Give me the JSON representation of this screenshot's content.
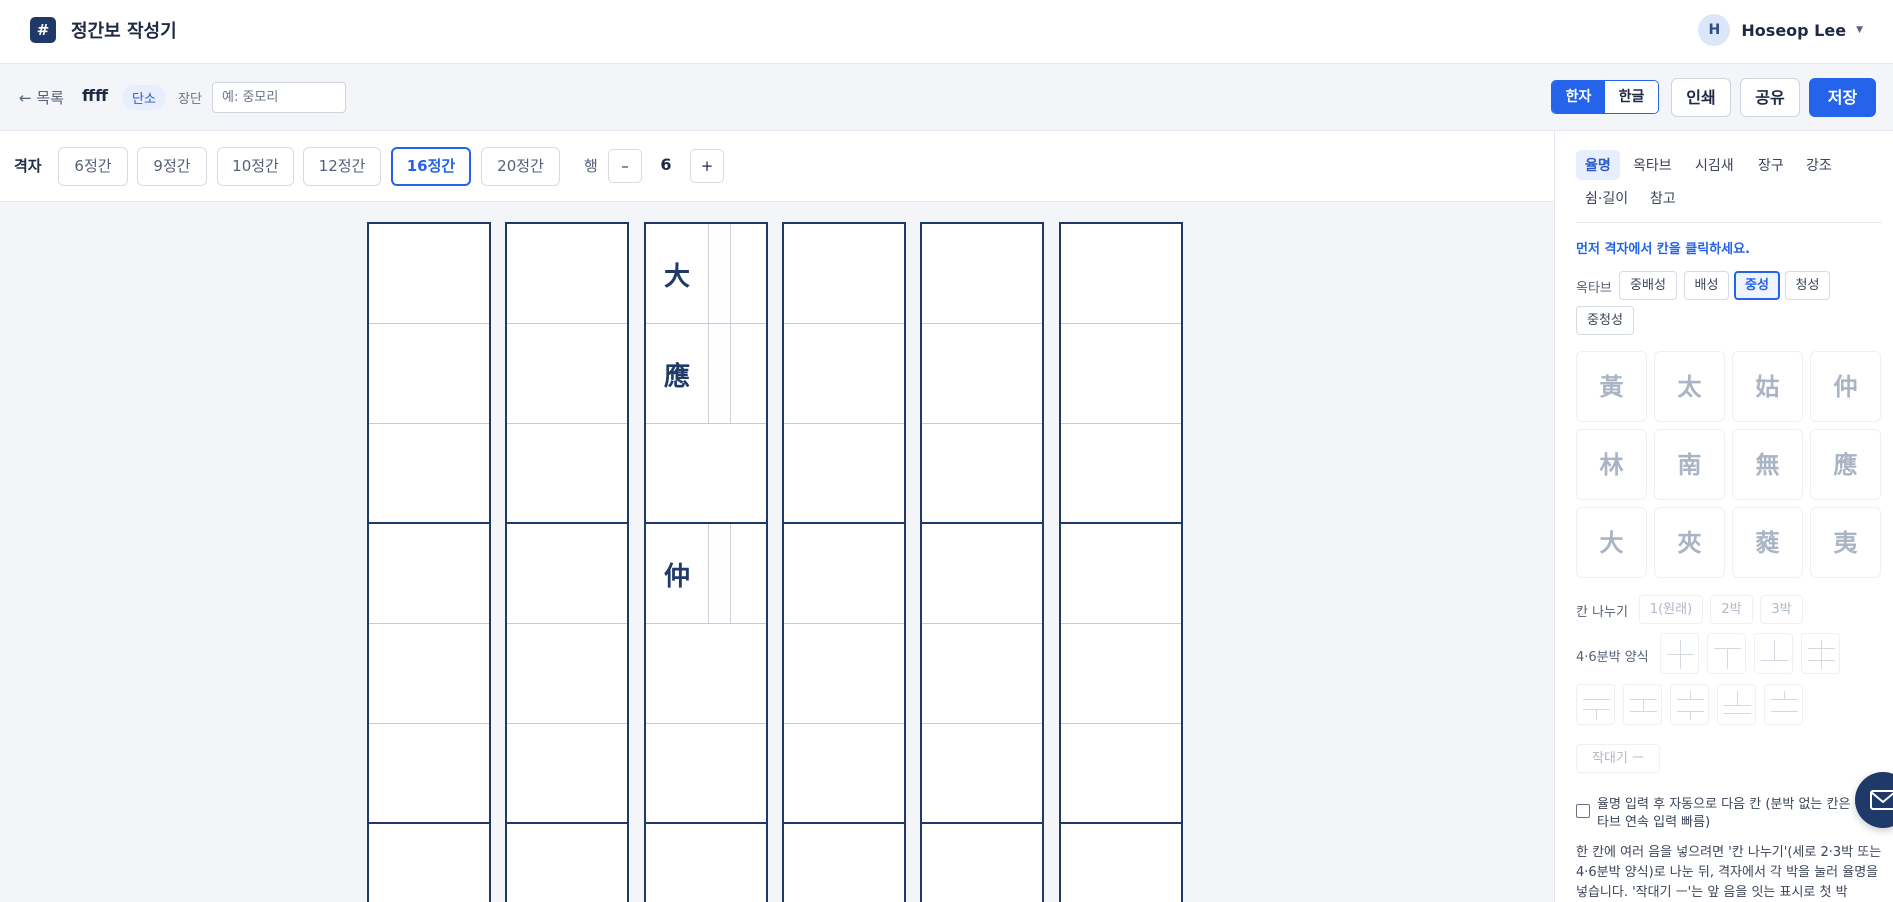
{
  "header": {
    "logo_glyph": "#",
    "app_title": "정간보 작성기",
    "user": {
      "avatar_initial": "H",
      "name": "Hoseop Lee",
      "menu_icon": "caret-down-icon"
    }
  },
  "toolbar": {
    "back_label": "← 목록",
    "document_name": "ffff",
    "type_badge": "단소",
    "jangdan_label": "장단",
    "jangdan_placeholder": "예: 중모리",
    "jangdan_value": "",
    "script_toggle": {
      "options": [
        "한자",
        "한글"
      ],
      "selected": "한자"
    },
    "print_label": "인쇄",
    "share_label": "공유",
    "save_label": "저장"
  },
  "grid_bar": {
    "label": "격자",
    "options": [
      "6정간",
      "9정간",
      "10정간",
      "12정간",
      "16정간",
      "20정간"
    ],
    "selected": "16정간",
    "rows_label": "행",
    "decrement_label": "–",
    "rows_value": "6",
    "increment_label": "+"
  },
  "score": {
    "columns": [
      {
        "notes": []
      },
      {
        "notes": []
      },
      {
        "notes": [
          {
            "row": 0,
            "text": "大"
          },
          {
            "row": 1,
            "text": "應"
          },
          {
            "row": 3,
            "text": "仲"
          }
        ]
      },
      {
        "notes": []
      },
      {
        "notes": []
      },
      {
        "notes": []
      }
    ]
  },
  "panel": {
    "tabs": [
      "율명",
      "옥타브",
      "시김새",
      "장구",
      "강조",
      "쉼·길이",
      "참고"
    ],
    "active_tab": "율명",
    "hint": "먼저 격자에서 칸을 클릭하세요.",
    "octave_label": "옥타브",
    "octaves": [
      "중배성",
      "배성",
      "중성",
      "청성",
      "중청성"
    ],
    "octave_selected": "중성",
    "pitches": [
      "黃",
      "太",
      "姑",
      "仲",
      "林",
      "南",
      "無",
      "應",
      "大",
      "夾",
      "蕤",
      "夷"
    ],
    "split_label": "칸 나누기",
    "split_options": [
      "1(원래)",
      "2박",
      "3박"
    ],
    "pattern_label": "4·6분박 양식",
    "tie_label": "작대기 ㅡ",
    "auto_next": "율명 입력 후 자동으로 다음 칸 (분박 없는 칸은 옥타브 연속 입력 빠름)",
    "help": "한 칸에 여러 음을 넣으려면 '칸 나누기'(세로 2·3박 또는 4·6분박 양식)로 나눈 뒤, 격자에서 각 박을 눌러 율명을 넣습니다. '작대기 ㅡ'는 앞 음을 잇는 표시로 첫 박"
  },
  "fab_icon": "mail-icon",
  "colors": {
    "primary": "#2563eb",
    "navy": "#1f3a68",
    "muted_pitch": "#a9b4c4"
  }
}
